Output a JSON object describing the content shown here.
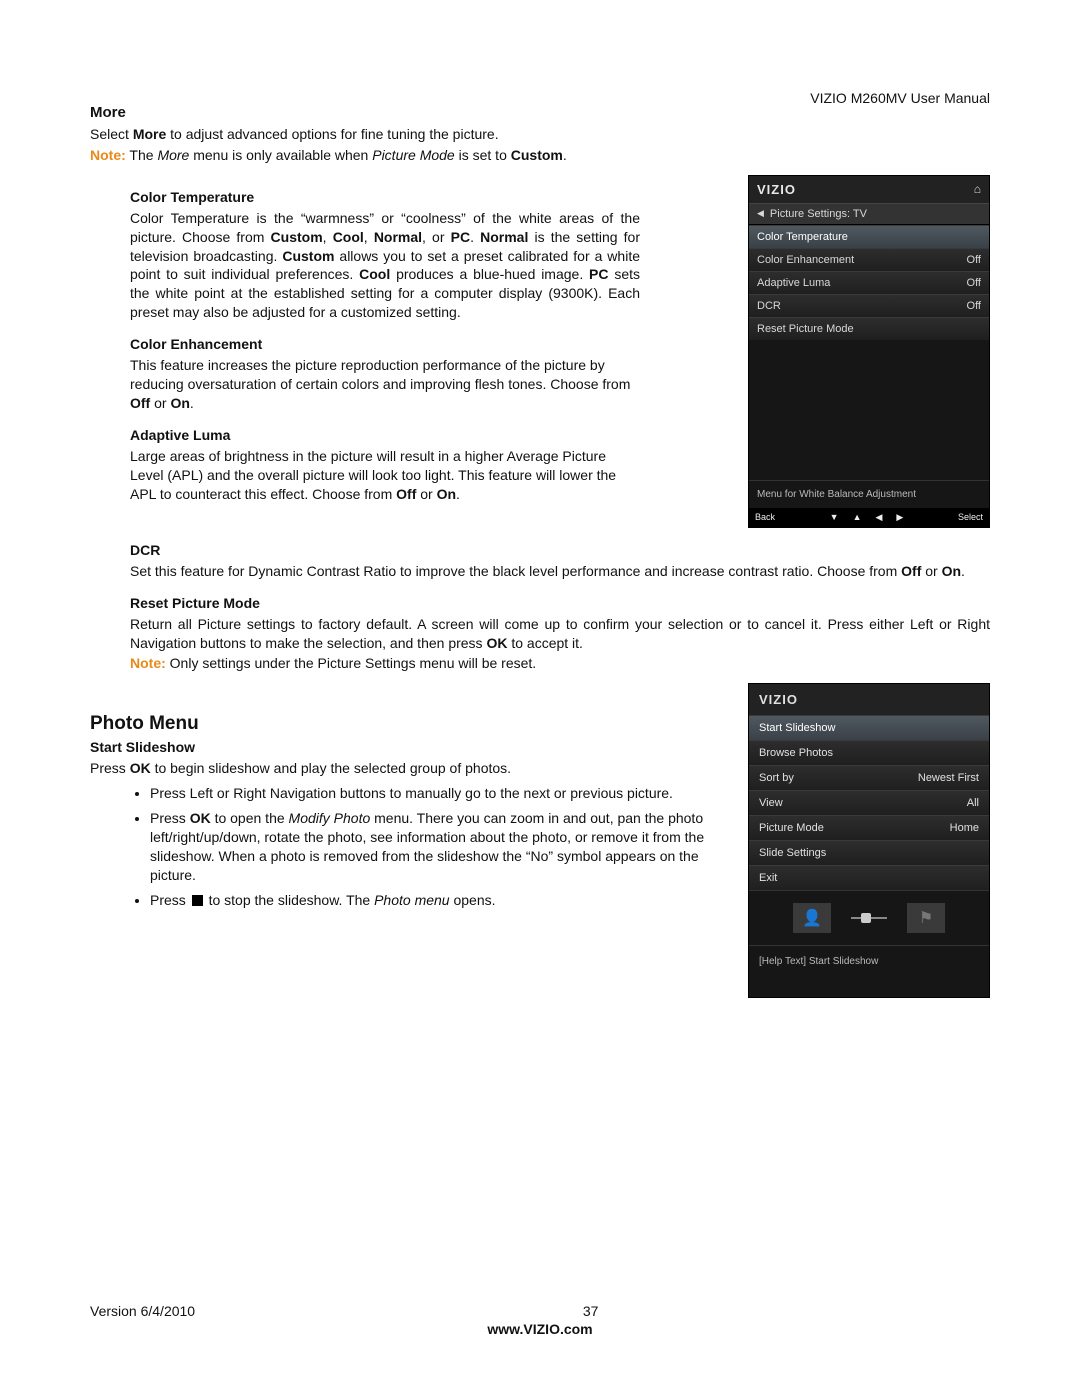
{
  "header": {
    "doc_title": "VIZIO M260MV User Manual"
  },
  "more": {
    "heading": "More",
    "line1_pre": "Select ",
    "line1_bold": "More",
    "line1_post": " to adjust advanced options for fine tuning the picture.",
    "note_label": "Note:",
    "note_pre": " The ",
    "note_i1": "More",
    "note_mid": " menu is only available when ",
    "note_i2": "Picture Mode",
    "note_post": " is set to ",
    "note_bold": "Custom",
    "note_end": "."
  },
  "ct": {
    "heading": "Color Temperature",
    "p1a": "Color Temperature is the “warmness” or “coolness” of the white areas of the picture. Choose from ",
    "b1": "Custom",
    "c1": ", ",
    "b2": "Cool",
    "c2": ", ",
    "b3": "Normal",
    "c3": ", or ",
    "b4": "PC",
    "c4": ". ",
    "b5": "Normal",
    "p1b": " is the setting for television broadcasting. ",
    "b6": "Custom",
    "p1c": " allows you to set a preset calibrated for a white point to suit individual preferences. ",
    "b7": "Cool",
    "p1d": " produces a blue-hued image. ",
    "b8": "PC",
    "p1e": " sets the white point at the established setting for a computer display (9300K). Each preset may also be adjusted for a customized setting."
  },
  "ce": {
    "heading": "Color Enhancement",
    "p_pre": "This feature increases the picture reproduction performance of the picture by reducing oversaturation of certain colors and improving flesh tones. Choose from ",
    "b1": "Off",
    "mid": " or ",
    "b2": "On",
    "end": "."
  },
  "al": {
    "heading": "Adaptive Luma",
    "p_pre": "Large areas of brightness in the picture will result in a higher Average Picture Level (APL) and the overall picture will look too light. This feature will lower the APL to counteract this effect. Choose from ",
    "b1": "Off",
    "mid": " or ",
    "b2": "On",
    "end": "."
  },
  "dcr": {
    "heading": "DCR",
    "p_pre": "Set this feature for Dynamic Contrast Ratio to improve the black level performance and increase contrast ratio. Choose from ",
    "b1": "Off",
    "mid": " or ",
    "b2": "On",
    "end": "."
  },
  "rpm": {
    "heading": "Reset Picture Mode",
    "p_pre": "Return all Picture settings to factory default. A screen will come up to confirm your selection or to cancel it. Press either Left or Right Navigation buttons to make the selection, and then press ",
    "b1": "OK",
    "p_post": " to accept it.",
    "note_label": "Note:",
    "note_text": " Only settings under the Picture Settings menu will be reset."
  },
  "photo": {
    "heading": "Photo Menu",
    "ss_heading": "Start Slideshow",
    "ss_pre": "Press ",
    "ss_b1": "OK",
    "ss_post": " to begin slideshow and play the selected group of photos.",
    "li1": "Press Left or Right Navigation buttons to manually go to the next or previous picture.",
    "li2_pre": "Press ",
    "li2_b1": "OK",
    "li2_mid": " to open the ",
    "li2_i1": "Modify Photo",
    "li2_post": " menu. There you can zoom in and out, pan the photo left/right/up/down, rotate the photo, see information about the photo, or remove it from the slideshow. When a photo is removed from the slideshow the “No” symbol appears on the picture.",
    "li3_pre": "Press ",
    "li3_mid": " to stop the slideshow. The ",
    "li3_i1": "Photo menu",
    "li3_post": " opens."
  },
  "osd1": {
    "logo": "VIZIO",
    "crumb": "Picture Settings: TV",
    "rows": [
      {
        "label": "Color Temperature",
        "value": "",
        "hi": true
      },
      {
        "label": "Color Enhancement",
        "value": "Off"
      },
      {
        "label": "Adaptive Luma",
        "value": "Off"
      },
      {
        "label": "DCR",
        "value": "Off"
      },
      {
        "label": "Reset Picture Mode",
        "value": ""
      }
    ],
    "help": "Menu for White Balance Adjustment",
    "nav_back": "Back",
    "nav_select": "Select"
  },
  "osd2": {
    "logo": "VIZIO",
    "rows": [
      {
        "label": "Start Slideshow",
        "value": "",
        "hi": true
      },
      {
        "label": "Browse Photos",
        "value": ""
      },
      {
        "label": "Sort by",
        "value": "Newest First"
      },
      {
        "label": "View",
        "value": "All"
      },
      {
        "label": "Picture Mode",
        "value": "Home"
      },
      {
        "label": "Slide Settings",
        "value": ""
      },
      {
        "label": "Exit",
        "value": ""
      }
    ],
    "help": "[Help Text] Start Slideshow"
  },
  "footer": {
    "version": "Version 6/4/2010",
    "page": "37",
    "url": "www.VIZIO.com"
  }
}
